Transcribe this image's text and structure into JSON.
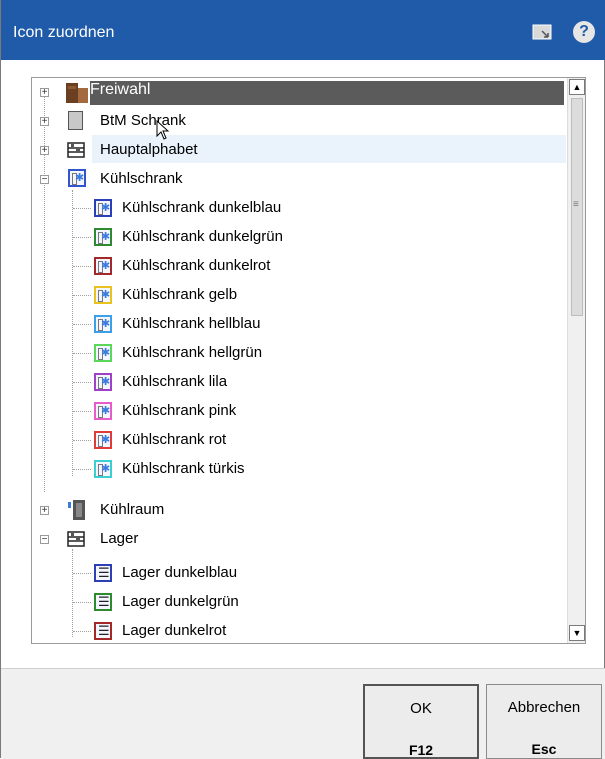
{
  "window": {
    "title": "Icon zuordnen",
    "help_glyph": "?"
  },
  "tree": {
    "items": [
      {
        "label": "Freiwahl",
        "expander": "+",
        "icon": "freiwahl-icon",
        "selected": true
      },
      {
        "label": "BtM Schrank",
        "expander": "+",
        "icon": "btm-cabinet-icon"
      },
      {
        "label": "Hauptalphabet",
        "expander": "+",
        "icon": "shelf-icon"
      },
      {
        "label": "Kühlschrank",
        "expander": "−",
        "icon": "fridge-icon",
        "children": [
          {
            "label": "Kühlschrank dunkelblau",
            "color": "#2c3fb5"
          },
          {
            "label": "Kühlschrank dunkelgrün",
            "color": "#2e8a2e"
          },
          {
            "label": "Kühlschrank dunkelrot",
            "color": "#a52828"
          },
          {
            "label": "Kühlschrank gelb",
            "color": "#e8c21e"
          },
          {
            "label": "Kühlschrank hellblau",
            "color": "#3aa0e8"
          },
          {
            "label": "Kühlschrank hellgrün",
            "color": "#5bd75b"
          },
          {
            "label": "Kühlschrank lila",
            "color": "#a040c8"
          },
          {
            "label": "Kühlschrank pink",
            "color": "#e85bc8"
          },
          {
            "label": "Kühlschrank rot",
            "color": "#e03a3a"
          },
          {
            "label": "Kühlschrank türkis",
            "color": "#3ad0d0"
          }
        ]
      },
      {
        "label": "Kühlraum",
        "expander": "+",
        "icon": "cold-room-icon"
      },
      {
        "label": "Lager",
        "expander": "−",
        "icon": "shelf-icon",
        "children": [
          {
            "label": "Lager dunkelblau",
            "color": "#2c3fb5"
          },
          {
            "label": "Lager dunkelgrün",
            "color": "#2e8a2e"
          },
          {
            "label": "Lager dunkelrot",
            "color": "#a52828"
          }
        ]
      }
    ]
  },
  "buttons": {
    "ok": {
      "label": "OK",
      "key": "F12"
    },
    "cancel": {
      "label": "Abbrechen",
      "key": "Esc"
    }
  },
  "scrollbar": {
    "up": "▲",
    "down": "▼",
    "grip": "≡"
  }
}
